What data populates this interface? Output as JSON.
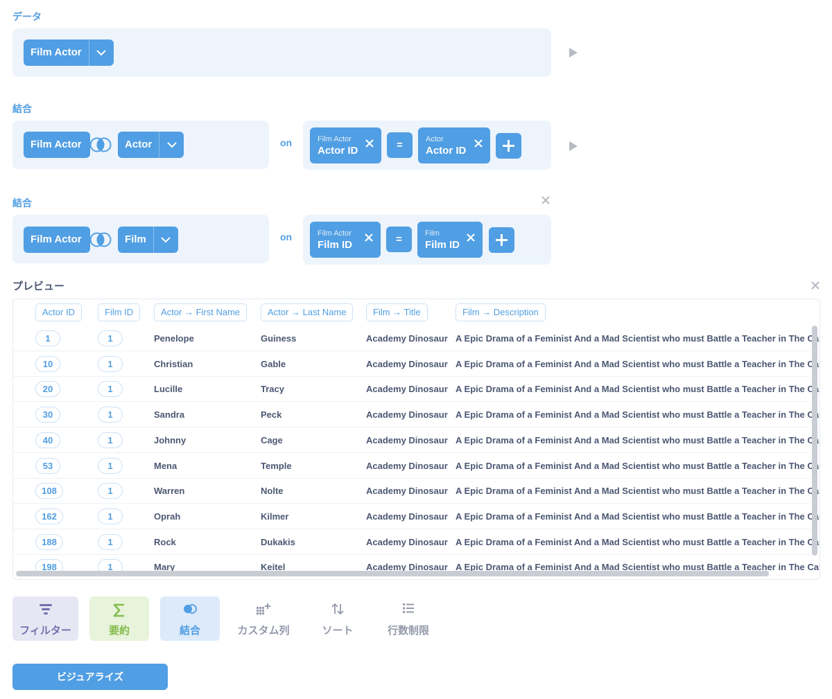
{
  "data_section": {
    "title": "データ",
    "source_table": "Film Actor"
  },
  "join1": {
    "title": "結合",
    "left_table": "Film Actor",
    "right_table": "Actor",
    "on_label": "on",
    "left_field": {
      "table": "Film Actor",
      "field": "Actor ID"
    },
    "operator": "=",
    "right_field": {
      "table": "Actor",
      "field": "Actor ID"
    }
  },
  "join2": {
    "title": "結合",
    "left_table": "Film Actor",
    "right_table": "Film",
    "on_label": "on",
    "left_field": {
      "table": "Film Actor",
      "field": "Film ID"
    },
    "operator": "=",
    "right_field": {
      "table": "Film",
      "field": "Film ID"
    }
  },
  "preview": {
    "title": "プレビュー",
    "columns": [
      "Actor ID",
      "Film ID",
      "Actor → First Name",
      "Actor → Last Name",
      "Film → Title",
      "Film → Description"
    ],
    "rows": [
      [
        "1",
        "1",
        "Penelope",
        "Guiness",
        "Academy Dinosaur",
        "A Epic Drama of a Feminist And a Mad Scientist who must Battle a Teacher in The Canadian"
      ],
      [
        "10",
        "1",
        "Christian",
        "Gable",
        "Academy Dinosaur",
        "A Epic Drama of a Feminist And a Mad Scientist who must Battle a Teacher in The Canadian"
      ],
      [
        "20",
        "1",
        "Lucille",
        "Tracy",
        "Academy Dinosaur",
        "A Epic Drama of a Feminist And a Mad Scientist who must Battle a Teacher in The Canadian"
      ],
      [
        "30",
        "1",
        "Sandra",
        "Peck",
        "Academy Dinosaur",
        "A Epic Drama of a Feminist And a Mad Scientist who must Battle a Teacher in The Canadian"
      ],
      [
        "40",
        "1",
        "Johnny",
        "Cage",
        "Academy Dinosaur",
        "A Epic Drama of a Feminist And a Mad Scientist who must Battle a Teacher in The Canadian"
      ],
      [
        "53",
        "1",
        "Mena",
        "Temple",
        "Academy Dinosaur",
        "A Epic Drama of a Feminist And a Mad Scientist who must Battle a Teacher in The Canadian"
      ],
      [
        "108",
        "1",
        "Warren",
        "Nolte",
        "Academy Dinosaur",
        "A Epic Drama of a Feminist And a Mad Scientist who must Battle a Teacher in The Canadian"
      ],
      [
        "162",
        "1",
        "Oprah",
        "Kilmer",
        "Academy Dinosaur",
        "A Epic Drama of a Feminist And a Mad Scientist who must Battle a Teacher in The Canadian"
      ],
      [
        "188",
        "1",
        "Rock",
        "Dukakis",
        "Academy Dinosaur",
        "A Epic Drama of a Feminist And a Mad Scientist who must Battle a Teacher in The Canadian"
      ],
      [
        "198",
        "1",
        "Mary",
        "Keitel",
        "Academy Dinosaur",
        "A Epic Drama of a Feminist And a Mad Scientist who must Battle a Teacher in The Canadian"
      ]
    ]
  },
  "actions": [
    {
      "label": "フィルター",
      "icon": "filter-icon",
      "bg": "#e6e7f3",
      "color": "#7172ad"
    },
    {
      "label": "要約",
      "icon": "sigma-icon",
      "bg": "#e8f3db",
      "color": "#84bb4c"
    },
    {
      "label": "結合",
      "icon": "join-icon",
      "bg": "#dceafa",
      "color": "#509ee3"
    },
    {
      "label": "カスタム列",
      "icon": "custom-column-icon",
      "bg": "",
      "color": "#949aab"
    },
    {
      "label": "ソート",
      "icon": "sort-icon",
      "bg": "",
      "color": "#949aab"
    },
    {
      "label": "行数制限",
      "icon": "list-icon",
      "bg": "",
      "color": "#949aab"
    }
  ],
  "visualize_label": "ビジュアライズ",
  "colors": {
    "brand": "#509ee3",
    "panel_bg": "#edf4fc",
    "text": "#4c5773",
    "muted": "#b8bbc3"
  }
}
